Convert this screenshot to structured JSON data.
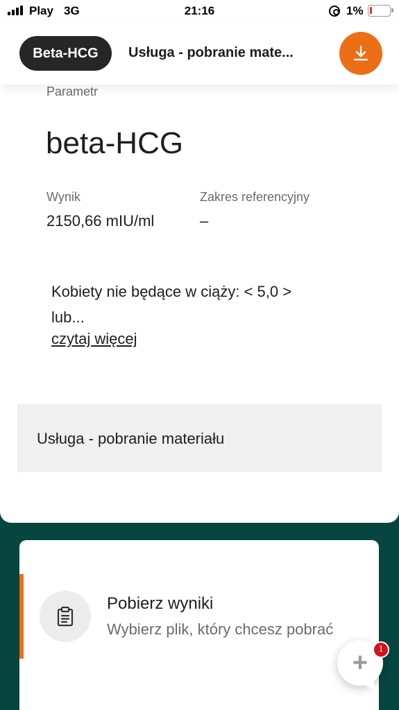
{
  "status_bar": {
    "carrier": "Play",
    "network": "3G",
    "time": "21:16",
    "battery_percent": "1%",
    "battery_color": "#e0302a"
  },
  "tabs": {
    "active": "Beta-HCG",
    "inactive": "Usługa - pobranie mate..."
  },
  "download_button": {
    "icon": "download-icon",
    "color": "#ec6e15"
  },
  "result": {
    "param_label": "Parametr",
    "param_name": "beta-HCG",
    "result_label": "Wynik",
    "result_value": "2150,66 mIU/ml",
    "range_label": "Zakres referencyjny",
    "range_value": "–",
    "note": "Kobiety nie będące w ciąży: < 5,0 > lub...",
    "read_more": "czytaj więcej"
  },
  "service": {
    "label": "Usługa - pobranie materiału"
  },
  "download_card": {
    "icon": "clipboard-icon",
    "title": "Pobierz wyniki",
    "subtitle": "Wybierz plik, który chcesz pobrać"
  },
  "chat": {
    "icon": "plus-icon",
    "plus": "+",
    "badge": "1"
  },
  "colors": {
    "accent": "#ec6e15",
    "dark_green": "#074541",
    "tab_active_bg": "#262626"
  }
}
